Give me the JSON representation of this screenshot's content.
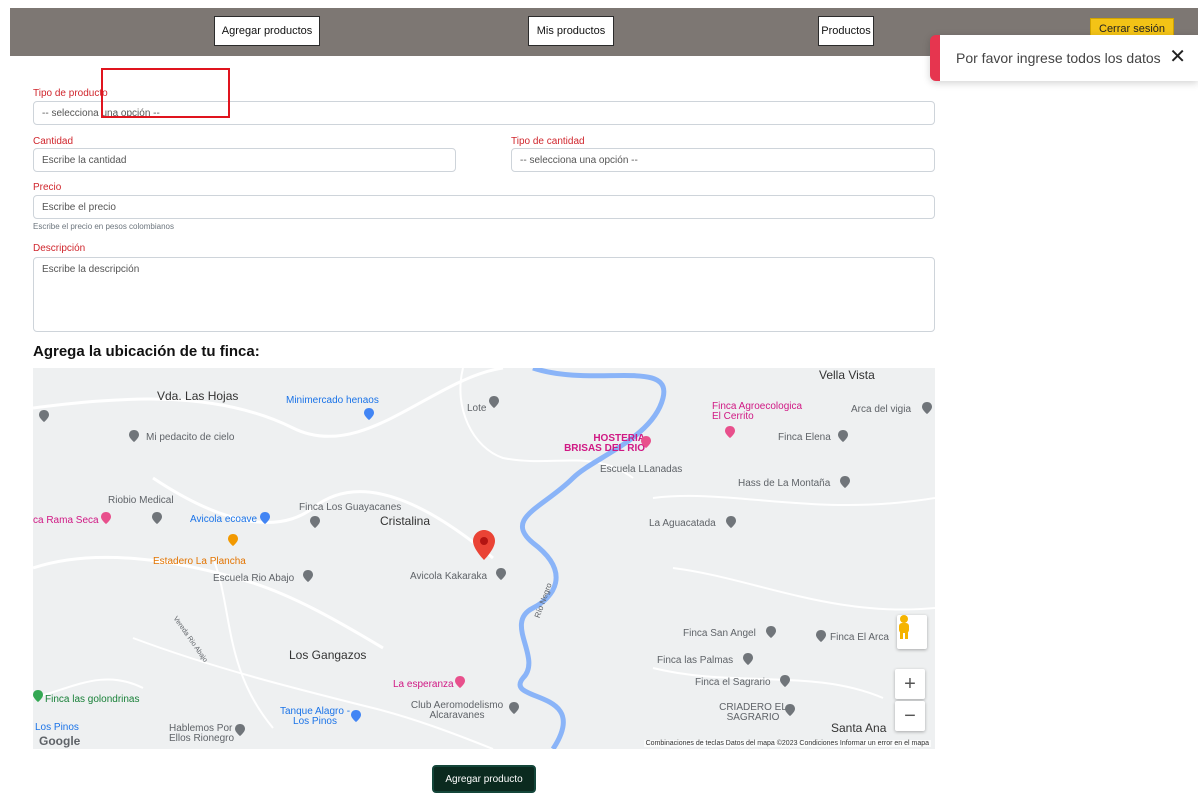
{
  "nav": {
    "add_products": "Agregar productos",
    "my_products": "Mis productos",
    "products": "Productos",
    "logout": "Cerrar sesión"
  },
  "toast": {
    "message": "Por favor ingrese todos los datos",
    "close": "✕"
  },
  "form": {
    "product_type": {
      "label": "Tipo de producto",
      "value": "-- selecciona una opción --"
    },
    "quantity": {
      "label": "Cantidad",
      "placeholder": "Escribe la cantidad"
    },
    "quantity_type": {
      "label": "Tipo de cantidad",
      "value": "-- selecciona una opción --"
    },
    "price": {
      "label": "Precio",
      "placeholder": "Escribe el precio",
      "help": "Escribe el precio en pesos colombianos"
    },
    "description": {
      "label": "Descripción",
      "placeholder": "Escribe la descripción"
    }
  },
  "map_section": {
    "title": "Agrega la ubicación de tu finca:",
    "labels": {
      "vella_vista": "Vella Vista",
      "las_hojas": "Vda. Las Hojas",
      "minimercado": "Minimercado henaos",
      "lote": "Lote",
      "finca_agro": "Finca Agroecologica El Cerrito",
      "arca": "Arca del vigia",
      "pedacito": "Mi pedacito de cielo",
      "hosteria": "HOSTERIA BRISAS DEL RIO",
      "finca_elena": "Finca Elena",
      "escuela_llanadas": "Escuela LLanadas",
      "hass": "Hass de La Montaña",
      "riobio": "Riobio Medical",
      "rama_seca": "ca Rama Seca",
      "avicola_ecoave": "Avicola ecoave",
      "guayacanes": "Finca Los Guayacanes",
      "cristalina": "Cristalina",
      "aguacatada": "La Aguacatada",
      "estadero": "Estadero La Plancha",
      "escuela_rio_abajo": "Escuela Rio Abajo",
      "kakaraka": "Avicola Kakaraka",
      "rio_negro": "Río Negro",
      "vereda": "Vereda Rio Abajo",
      "san_angel": "Finca San Angel",
      "el_arca": "Finca El Arca",
      "gangazos": "Los Gangazos",
      "las_palmas": "Finca las Palmas",
      "esperanza": "La esperanza",
      "sagrario": "Finca el Sagrario",
      "golondrinas": "Finca las golondrinas",
      "tanque": "Tanque Alagro - Los Pinos",
      "aeromodelismo": "Club Aeromodelismo Alcaravanes",
      "criadero": "CRIADERO EL SAGRARIO",
      "los_pinos": "Los Pinos",
      "hablemos": "Hablemos Por Ellos Rionegro",
      "santa_ana": "Santa Ana",
      "google": "Google"
    },
    "zoom_in": "+",
    "zoom_out": "−",
    "attribution": "Combinaciones de teclas   Datos del mapa ©2023   Condiciones   Informar un error en el mapa"
  },
  "submit": "Agregar producto",
  "colors": {
    "topbar": "#7d7773",
    "label_red": "#d0262d",
    "logout_yellow": "#f3c316",
    "toast_accent": "#e6354f",
    "submit_bg": "#0b2a1f"
  }
}
